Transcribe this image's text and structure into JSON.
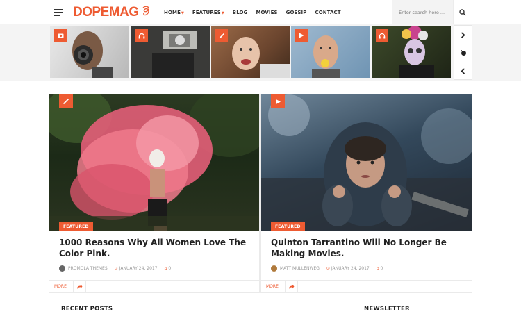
{
  "brand": {
    "name": "DOPEMAG"
  },
  "nav": {
    "items": [
      {
        "label": "HOME",
        "dropdown": true
      },
      {
        "label": "FEATURES",
        "dropdown": true
      },
      {
        "label": "BLOG",
        "dropdown": false
      },
      {
        "label": "MOVIES",
        "dropdown": false
      },
      {
        "label": "GOSSIP",
        "dropdown": false
      },
      {
        "label": "CONTACT",
        "dropdown": false
      }
    ]
  },
  "search": {
    "placeholder": "Enter search here ..."
  },
  "accent": "#ee5b32",
  "strip": {
    "thumbs": [
      {
        "icon": "camera-icon"
      },
      {
        "icon": "headphones-icon"
      },
      {
        "icon": "pencil-icon"
      },
      {
        "icon": "play-icon"
      },
      {
        "icon": "headphones-icon"
      }
    ]
  },
  "featured": [
    {
      "tag": "FEATURED",
      "icon": "pencil-icon",
      "title": "1000 Reasons Why All Women Love The Color Pink.",
      "author": "PROMOLA THEMES",
      "date": "JANUARY 24, 2017",
      "comments": "0",
      "more": "MORE"
    },
    {
      "tag": "FEATURED",
      "icon": "play-icon",
      "title": "Quinton Tarrantino Will No Longer Be Making Movies.",
      "author": "MATT MULLENWEG",
      "date": "JANUARY 24, 2017",
      "comments": "0",
      "more": "MORE"
    }
  ],
  "sections": {
    "recent": "RECENT POSTS",
    "newsletter": "NEWSLETTER"
  }
}
